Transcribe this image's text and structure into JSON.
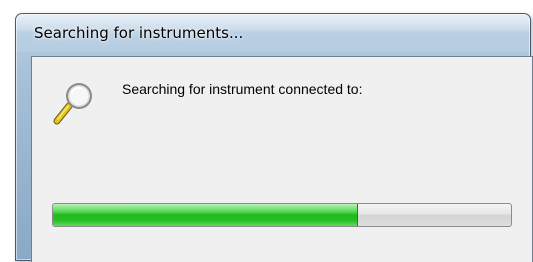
{
  "window": {
    "title": "Searching for instruments..."
  },
  "dialog": {
    "icon": "magnifier-icon",
    "message": "Searching for instrument connected to:",
    "progress": 0.665
  },
  "colors": {
    "progress_fill": "#1fb91f",
    "client_background": "#f0f0f0",
    "frame": "#a9c2da"
  }
}
